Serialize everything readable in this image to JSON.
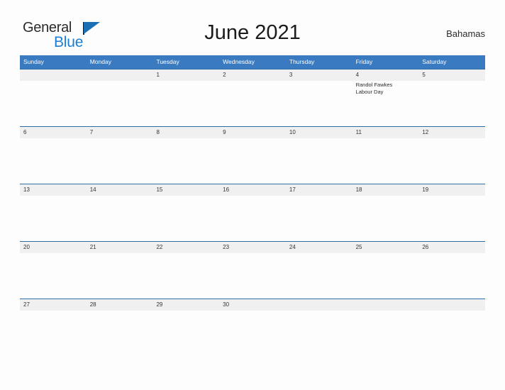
{
  "logo": {
    "text_dark": "General",
    "text_blue": "Blue",
    "flag_icon": "triangle-flag-icon",
    "brand_color": "#1a7fd4",
    "flag_color": "#1a6fb5"
  },
  "header": {
    "title": "June 2021",
    "country": "Bahamas"
  },
  "colors": {
    "header_bar": "#3a7ac0",
    "week_rule": "#2e6ca8",
    "week_band": "#f0f0f0",
    "page_background": "#fdfdfd",
    "text": "#2b2b2b"
  },
  "weekdays": [
    "Sunday",
    "Monday",
    "Tuesday",
    "Wednesday",
    "Thursday",
    "Friday",
    "Saturday"
  ],
  "weeks": [
    {
      "days": [
        {
          "num": "",
          "events": []
        },
        {
          "num": "",
          "events": []
        },
        {
          "num": "1",
          "events": []
        },
        {
          "num": "2",
          "events": []
        },
        {
          "num": "3",
          "events": []
        },
        {
          "num": "4",
          "events": [
            "Randol Fawkes",
            "Labour Day"
          ]
        },
        {
          "num": "5",
          "events": []
        }
      ]
    },
    {
      "days": [
        {
          "num": "6",
          "events": []
        },
        {
          "num": "7",
          "events": []
        },
        {
          "num": "8",
          "events": []
        },
        {
          "num": "9",
          "events": []
        },
        {
          "num": "10",
          "events": []
        },
        {
          "num": "11",
          "events": []
        },
        {
          "num": "12",
          "events": []
        }
      ]
    },
    {
      "days": [
        {
          "num": "13",
          "events": []
        },
        {
          "num": "14",
          "events": []
        },
        {
          "num": "15",
          "events": []
        },
        {
          "num": "16",
          "events": []
        },
        {
          "num": "17",
          "events": []
        },
        {
          "num": "18",
          "events": []
        },
        {
          "num": "19",
          "events": []
        }
      ]
    },
    {
      "days": [
        {
          "num": "20",
          "events": []
        },
        {
          "num": "21",
          "events": []
        },
        {
          "num": "22",
          "events": []
        },
        {
          "num": "23",
          "events": []
        },
        {
          "num": "24",
          "events": []
        },
        {
          "num": "25",
          "events": []
        },
        {
          "num": "26",
          "events": []
        }
      ]
    },
    {
      "days": [
        {
          "num": "27",
          "events": []
        },
        {
          "num": "28",
          "events": []
        },
        {
          "num": "29",
          "events": []
        },
        {
          "num": "30",
          "events": []
        },
        {
          "num": "",
          "events": []
        },
        {
          "num": "",
          "events": []
        },
        {
          "num": "",
          "events": []
        }
      ]
    }
  ]
}
